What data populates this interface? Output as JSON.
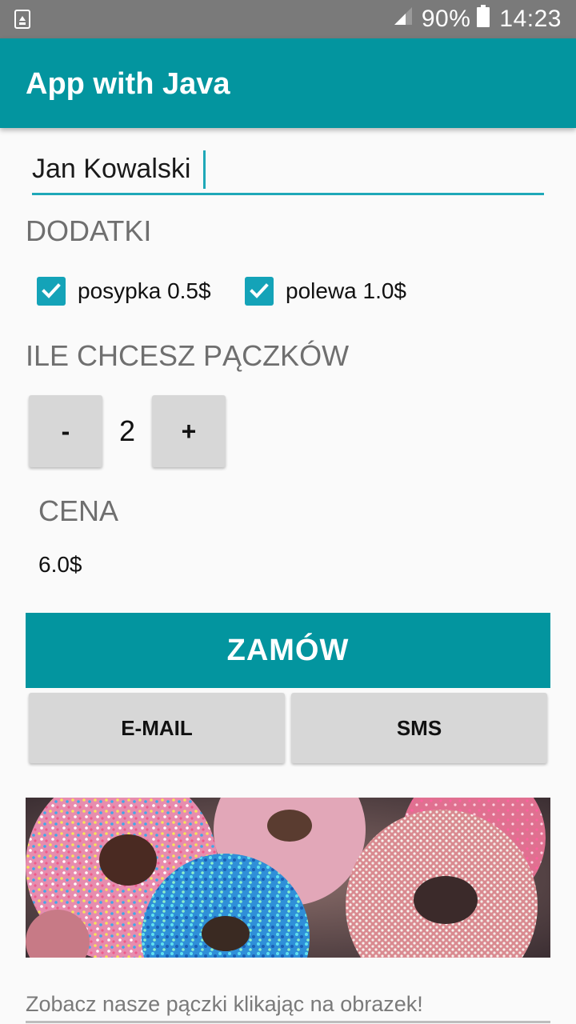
{
  "status_bar": {
    "battery_percent": "90%",
    "time": "14:23",
    "icons": [
      "recycle-icon",
      "signal-icon",
      "battery-icon"
    ]
  },
  "app_bar": {
    "title": "App with Java",
    "color": "#03959f"
  },
  "form": {
    "name_value": "Jan Kowalski",
    "toppings_heading": "DODATKI",
    "toppings": [
      {
        "label": "posypka 0.5$",
        "checked": true
      },
      {
        "label": "polewa 1.0$",
        "checked": true
      }
    ],
    "quantity_heading": "ILE CHCESZ PĄCZKÓW",
    "decrement_label": "-",
    "increment_label": "+",
    "quantity": "2",
    "price_heading": "CENA",
    "price_value": "6.0$"
  },
  "actions": {
    "order_label": "ZAMÓW",
    "email_label": "E-MAIL",
    "sms_label": "SMS"
  },
  "gallery": {
    "caption": "Zobacz nasze pączki klikając na obrazek!"
  },
  "colors": {
    "accent": "#03959f",
    "checkbox": "#14a3b8",
    "button_gray": "#d7d7d7"
  }
}
